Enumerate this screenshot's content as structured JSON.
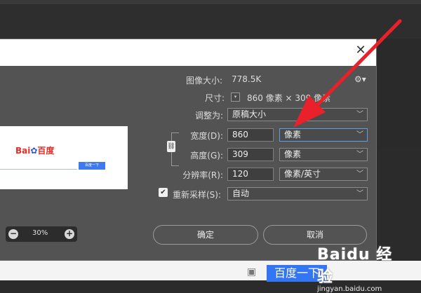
{
  "dialog": {
    "image_size_label": "图像大小:",
    "image_size_value": "778.5K",
    "dimensions_label": "尺寸:",
    "dimensions_value": "860 像素 × 309 像素",
    "fit_label": "调整为:",
    "fit_value": "原稿大小",
    "width_label": "宽度(D):",
    "width_value": "860",
    "width_unit": "像素",
    "height_label": "高度(G):",
    "height_value": "309",
    "height_unit": "像素",
    "resolution_label": "分辨率(R):",
    "resolution_value": "120",
    "resolution_unit": "像素/英寸",
    "resample_label": "重新采样(S):",
    "resample_value": "自动",
    "resample_checked": true,
    "ok_label": "确定",
    "cancel_label": "取消"
  },
  "preview": {
    "zoom_value": "30%",
    "logo_text_bai": "Bai",
    "logo_text_du": "百度",
    "search_button": "百度一下"
  },
  "page": {
    "baidu_button": "百度一下"
  },
  "watermark": {
    "main": "Baidu 经验",
    "sub": "jingyan.baidu.com"
  },
  "colors": {
    "dialog_bg": "#535353",
    "accent_blue": "#3476f2",
    "arrow_red": "#e8212a"
  }
}
